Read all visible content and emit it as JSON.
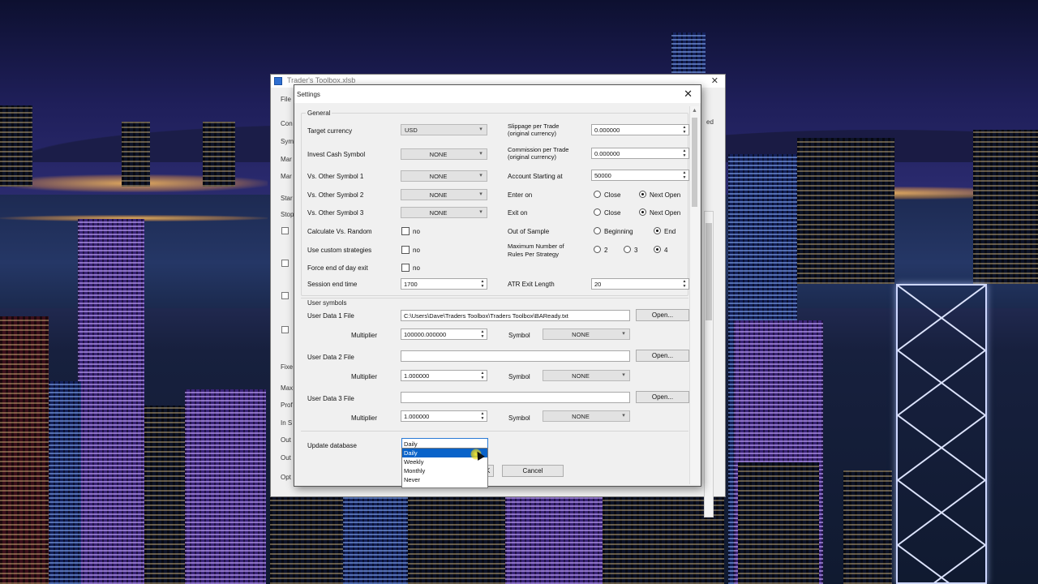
{
  "back_window": {
    "title": "Trader's Toolbox.xlsb",
    "partial_labels": [
      "File",
      "Con",
      "Sym",
      "Mar",
      "Mar",
      "Star",
      "Stop",
      "Fixe",
      "Max",
      "Prof",
      "In S",
      "Out",
      "Out",
      "Opt",
      "ed"
    ]
  },
  "dialog": {
    "title": "Settings",
    "general_group": "General",
    "user_symbols_group": "User symbols",
    "left_fields": [
      {
        "label": "Target currency",
        "value": "USD"
      },
      {
        "label": "Invest Cash Symbol",
        "value": "NONE"
      },
      {
        "label": "Vs. Other Symbol 1",
        "value": "NONE"
      },
      {
        "label": "Vs. Other Symbol 2",
        "value": "NONE"
      },
      {
        "label": "Vs. Other Symbol 3",
        "value": "NONE"
      }
    ],
    "checkbox_fields": [
      {
        "label": "Calculate Vs. Random",
        "check_label": "no"
      },
      {
        "label": "Use custom strategies",
        "check_label": "no"
      },
      {
        "label": "Force end of day exit",
        "check_label": "no"
      }
    ],
    "session_end": {
      "label": "Session end time",
      "value": "1700"
    },
    "slippage": {
      "label_line1": "Slippage per Trade",
      "label_line2": "(original currency)",
      "value": "0.000000"
    },
    "commission": {
      "label_line1": "Commission per Trade",
      "label_line2": "(original currency)",
      "value": "0.000000"
    },
    "account_start": {
      "label": "Account Starting at",
      "value": "50000"
    },
    "enter_on": {
      "label": "Enter on",
      "options": [
        "Close",
        "Next Open"
      ],
      "selected": "Next Open"
    },
    "exit_on": {
      "label": "Exit on",
      "options": [
        "Close",
        "Next Open"
      ],
      "selected": "Next Open"
    },
    "out_of_sample": {
      "label": "Out of Sample",
      "options": [
        "Beginning",
        "End"
      ],
      "selected": "End"
    },
    "max_rules": {
      "label_line1": "Maximum Number of",
      "label_line2": "Rules Per Strategy",
      "options": [
        "2",
        "3",
        "4"
      ],
      "selected": "4"
    },
    "atr_exit": {
      "label": "ATR Exit Length",
      "value": "20"
    },
    "user_data": [
      {
        "label": "User Data 1 File",
        "path": "C:\\Users\\Dave\\Traders Toolbox\\Traders Toolbox\\BAReady.txt",
        "multiplier_label": "Multiplier",
        "multiplier": "100000.000000",
        "symbol_label": "Symbol",
        "symbol": "NONE",
        "open_label": "Open..."
      },
      {
        "label": "User Data 2 File",
        "path": "",
        "multiplier_label": "Multiplier",
        "multiplier": "1.000000",
        "symbol_label": "Symbol",
        "symbol": "NONE",
        "open_label": "Open..."
      },
      {
        "label": "User Data 3 File",
        "path": "",
        "multiplier_label": "Multiplier",
        "multiplier": "1.000000",
        "symbol_label": "Symbol",
        "symbol": "NONE",
        "open_label": "Open..."
      }
    ],
    "update_db": {
      "label": "Update database",
      "value": "Daily",
      "options": [
        "Daily",
        "Weekly",
        "Monthly",
        "Never"
      ],
      "highlighted": "Daily"
    },
    "ok_label": "OK",
    "cancel_label": "Cancel"
  },
  "colors": {
    "highlight": "#0a63c9",
    "dialog_bg": "#f0f0f0"
  }
}
